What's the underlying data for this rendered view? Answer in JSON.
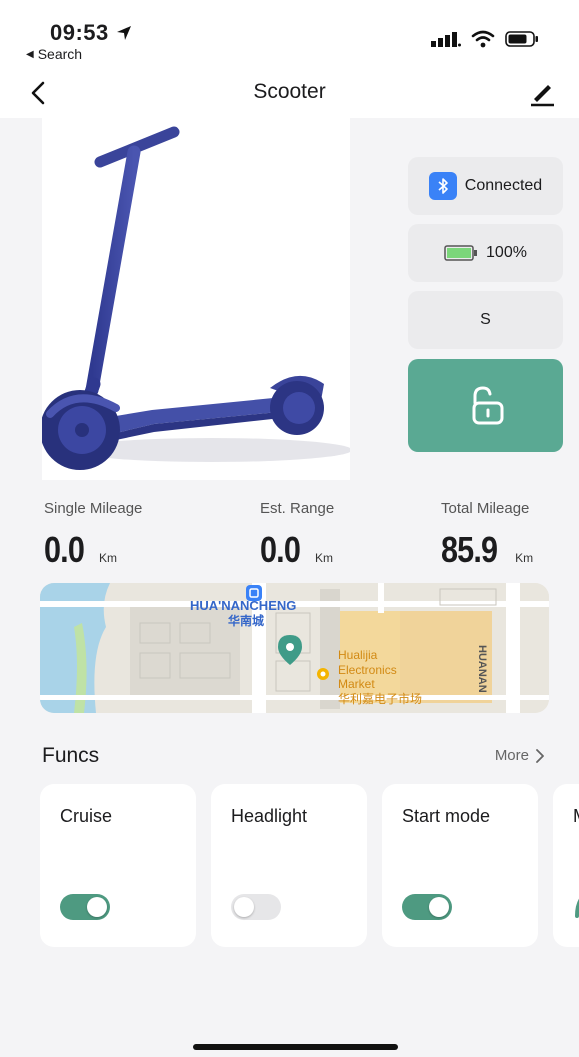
{
  "status_bar": {
    "time": "09:53",
    "back_app": "Search"
  },
  "nav": {
    "title": "Scooter"
  },
  "status_panel": {
    "connection": "Connected",
    "battery": "100%",
    "mode": "S"
  },
  "stats": [
    {
      "label": "Single Mileage",
      "value": "0.0",
      "unit": "Km"
    },
    {
      "label": "Est. Range",
      "value": "0.0",
      "unit": "Km"
    },
    {
      "label": "Total Mileage",
      "value": "85.9",
      "unit": "Km"
    }
  ],
  "map": {
    "area_en": "HUA'NANCHENG",
    "area_cn": "华南城",
    "poi_line1": "Hualijia",
    "poi_line2": "Electronics",
    "poi_line3": "Market",
    "poi_cn": "华利嘉电子市场",
    "road": "HUANAN"
  },
  "funcs": {
    "title": "Funcs",
    "more": "More",
    "cards": [
      {
        "name": "Cruise",
        "on": true
      },
      {
        "name": "Headlight",
        "on": false
      },
      {
        "name": "Start mode",
        "on": true
      },
      {
        "name": "M"
      }
    ]
  },
  "colors": {
    "accent": "#5aa993",
    "toggle_on": "#4e9a81",
    "scooter": "#3a449a",
    "bluetooth": "#3a82f7"
  }
}
